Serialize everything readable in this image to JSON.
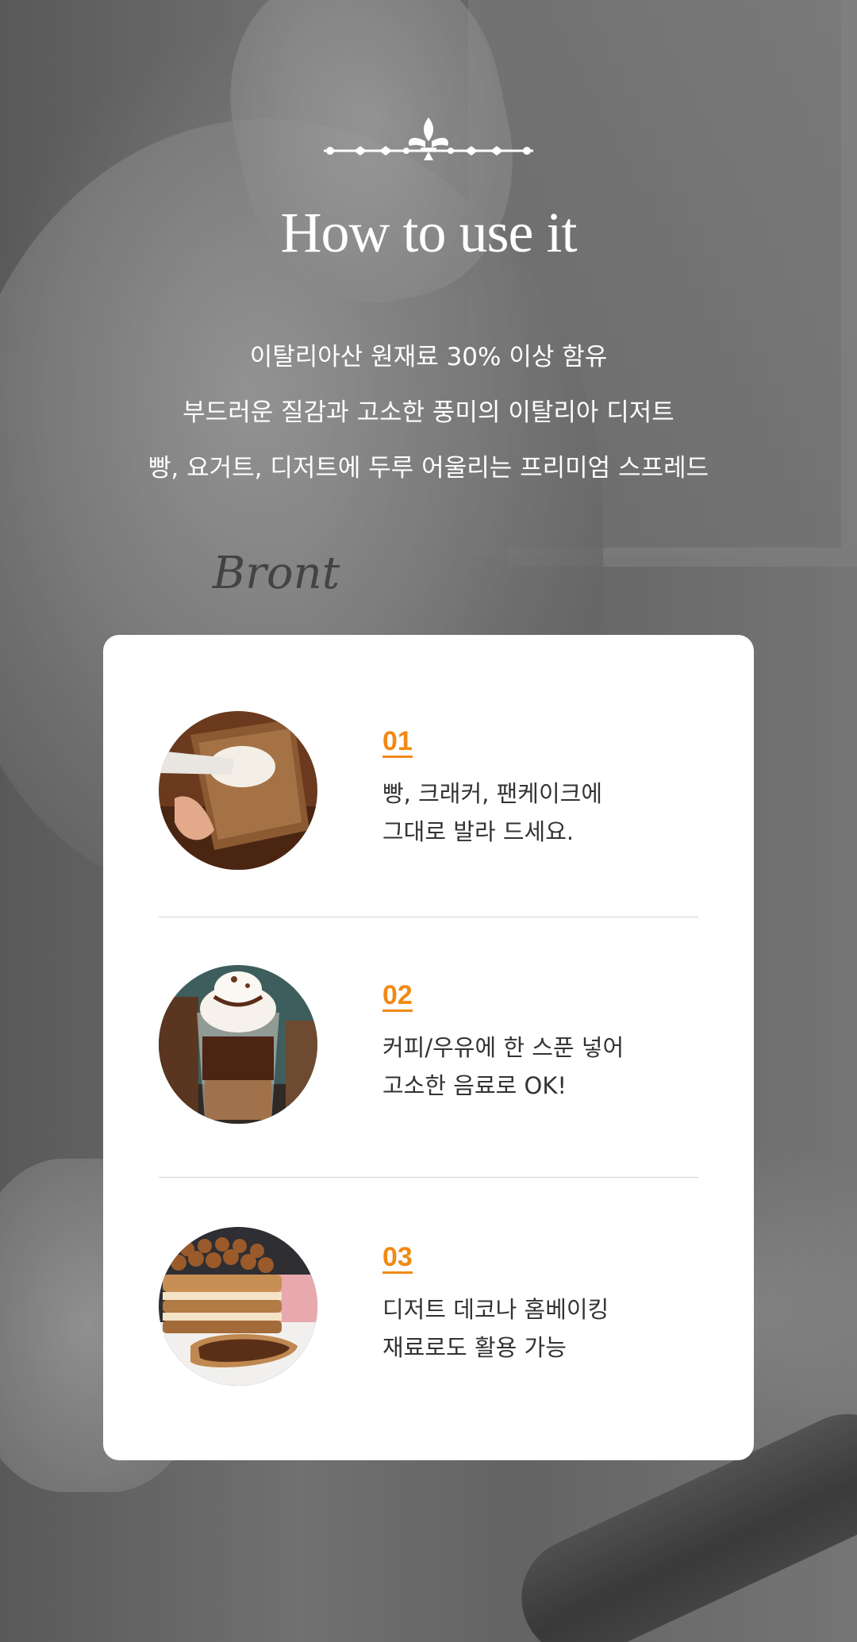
{
  "header": {
    "title": "How to use it",
    "intro_lines": [
      "이탈리아산 원재료 30% 이상 함유",
      "부드러운 질감과 고소한 풍미의 이탈리아 디저트",
      "빵, 요거트, 디저트에 두루 어울리는 프리미엄 스프레드"
    ]
  },
  "background": {
    "apron_logo": "Bront"
  },
  "steps": [
    {
      "number": "01",
      "line1": "빵, 크래커, 팬케이크에",
      "line2": "그대로 발라 드세요.",
      "image": "bread-spread-icon"
    },
    {
      "number": "02",
      "line1": "커피/우유에 한 스푼 넣어",
      "line2": "고소한 음료로 OK!",
      "image": "chocolate-drink-icon"
    },
    {
      "number": "03",
      "line1": "디저트 데코나 홈베이킹",
      "line2": "재료로도 활용 가능",
      "image": "hazelnut-toast-icon"
    }
  ],
  "colors": {
    "accent": "#f08a14",
    "card": "#ffffff",
    "text": "#333333"
  }
}
